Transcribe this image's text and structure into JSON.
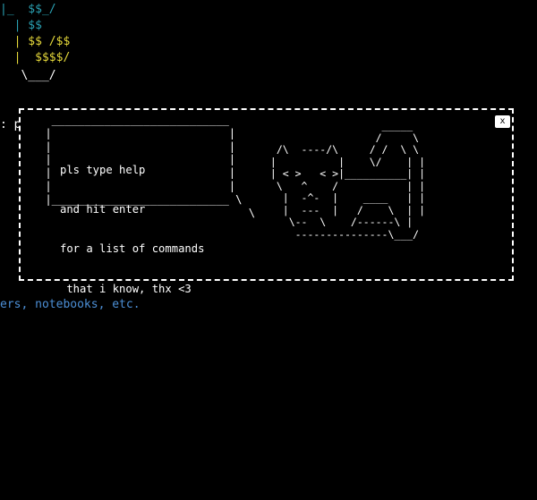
{
  "terminal": {
    "banner": [
      "|_  $$_/",
      "  | $$",
      "  | $$ /$$",
      "  |  $$$$/",
      "   \\___/"
    ],
    "prompt_fragment": ": pr",
    "hint": "ers, notebooks, etc."
  },
  "modal": {
    "close_label": "x",
    "bubble_frame": "  ___________________________\n |                           |\n |                           |\n |                           |\n |                           |\n |                           |\n |___________________________ \\\n                                \\",
    "message_lines": [
      "pls type help",
      "and hit enter",
      "for a list of commands",
      " that i know, thx <3"
    ],
    "art": "                   _____\n                  /     \\\n  /\\  ----/\\     / /  \\ \\\n |          |    \\/    | |\n | < >   < >|__________| |\n  \\   ^    /           | |\n   |  -^-  |    ____   | |\n   |  ---  |   /    \\  | |\n    \\--  \\    /------\\ |\n     ---------------\\___/"
  },
  "colors": {
    "banner_cyan": "#2aa1b3",
    "banner_yellow": "#e6d93a",
    "hint_blue": "#4c8fd6"
  }
}
